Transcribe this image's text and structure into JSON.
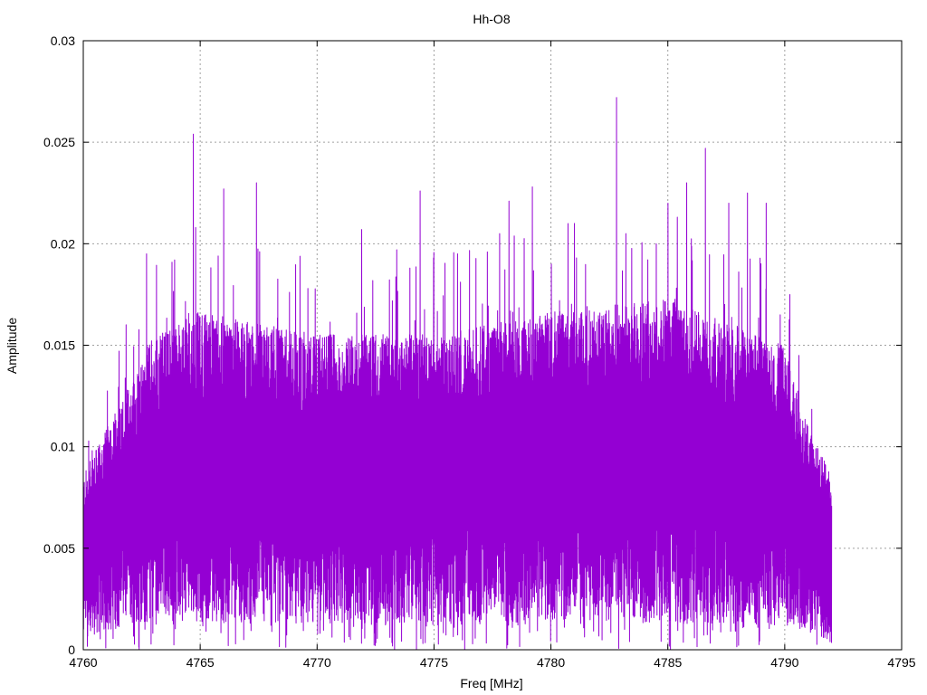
{
  "chart_data": {
    "type": "line",
    "title": "Hh-O8",
    "xlabel": "Freq [MHz]",
    "ylabel": "Amplitude",
    "xlim": [
      4760,
      4795
    ],
    "ylim": [
      0,
      0.03
    ],
    "x_ticks": [
      "4760",
      "4765",
      "4770",
      "4775",
      "4780",
      "4785",
      "4790",
      "4795"
    ],
    "y_ticks": [
      "0",
      "0.005",
      "0.01",
      "0.015",
      "0.02",
      "0.025",
      "0.03"
    ],
    "grid": true,
    "legend": "none",
    "series": [
      {
        "color": "#9400d3",
        "x_range": [
          4760,
          4792
        ],
        "x_step": 0.0125,
        "envelope": {
          "x": [
            4760,
            4761,
            4762,
            4763,
            4765,
            4770,
            4775,
            4780,
            4785,
            4790,
            4791,
            4792
          ],
          "upper": [
            0.0075,
            0.0095,
            0.0115,
            0.0135,
            0.0145,
            0.0135,
            0.0135,
            0.0145,
            0.015,
            0.013,
            0.0095,
            0.0075
          ],
          "lower": [
            0.002,
            0.003,
            0.004,
            0.0045,
            0.0045,
            0.004,
            0.004,
            0.0045,
            0.0045,
            0.004,
            0.003,
            0.0015
          ]
        },
        "peaks": [
          {
            "x": 4762.7,
            "y": 0.0195
          },
          {
            "x": 4763.9,
            "y": 0.0192
          },
          {
            "x": 4764.7,
            "y": 0.0254
          },
          {
            "x": 4764.8,
            "y": 0.0208
          },
          {
            "x": 4766.0,
            "y": 0.0227
          },
          {
            "x": 4767.4,
            "y": 0.023
          },
          {
            "x": 4769.6,
            "y": 0.0178
          },
          {
            "x": 4771.9,
            "y": 0.0207
          },
          {
            "x": 4773.4,
            "y": 0.0197
          },
          {
            "x": 4774.4,
            "y": 0.0226
          },
          {
            "x": 4776.0,
            "y": 0.0195
          },
          {
            "x": 4777.8,
            "y": 0.0205
          },
          {
            "x": 4778.2,
            "y": 0.0221
          },
          {
            "x": 4779.2,
            "y": 0.0228
          },
          {
            "x": 4781.0,
            "y": 0.021
          },
          {
            "x": 4782.8,
            "y": 0.0272
          },
          {
            "x": 4783.2,
            "y": 0.0205
          },
          {
            "x": 4784.5,
            "y": 0.02
          },
          {
            "x": 4785.0,
            "y": 0.022
          },
          {
            "x": 4785.8,
            "y": 0.023
          },
          {
            "x": 4786.6,
            "y": 0.0247
          },
          {
            "x": 4787.6,
            "y": 0.022
          },
          {
            "x": 4788.4,
            "y": 0.0225
          },
          {
            "x": 4789.2,
            "y": 0.022
          },
          {
            "x": 4789.8,
            "y": 0.0165
          },
          {
            "x": 4790.6,
            "y": 0.0145
          },
          {
            "x": 4791.3,
            "y": 0.009
          }
        ]
      }
    ]
  }
}
